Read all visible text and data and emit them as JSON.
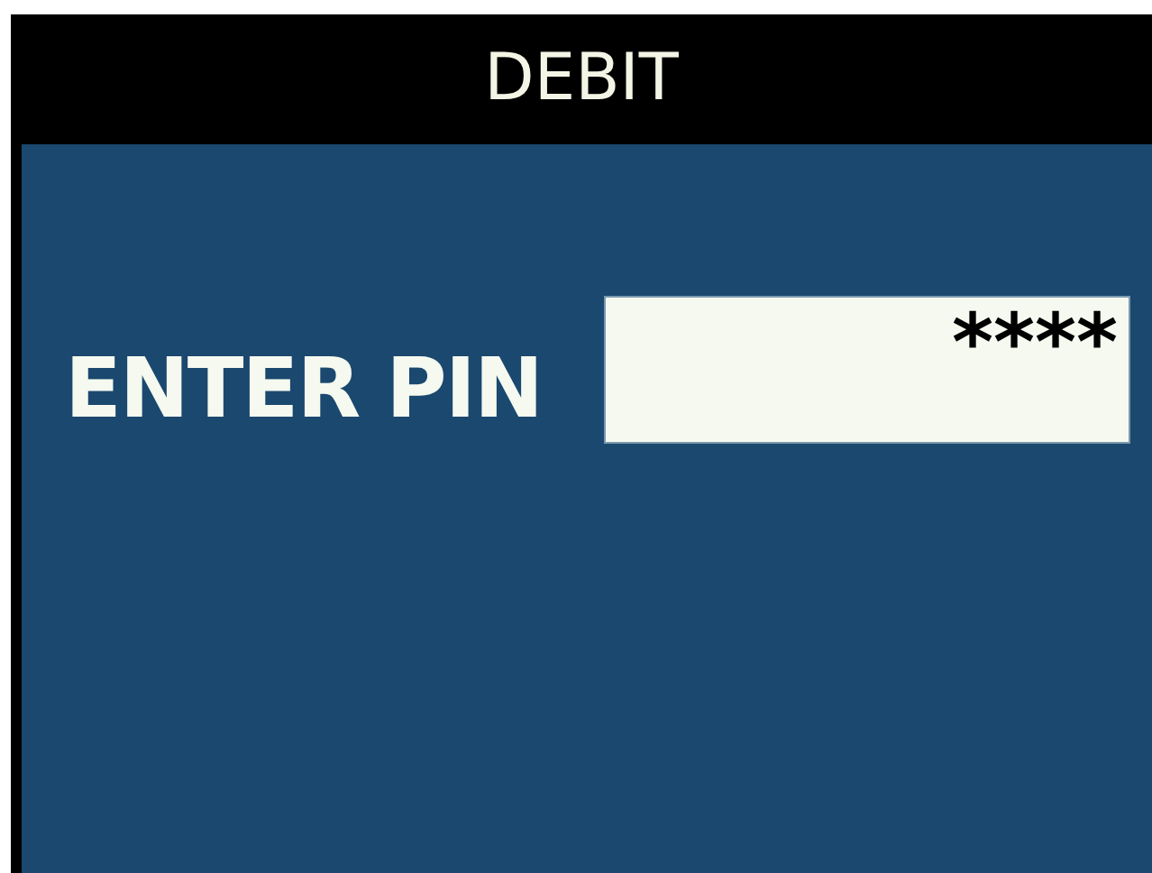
{
  "window": {
    "title": "DEBIT"
  },
  "pin": {
    "label": "ENTER PIN",
    "value": "****"
  }
}
